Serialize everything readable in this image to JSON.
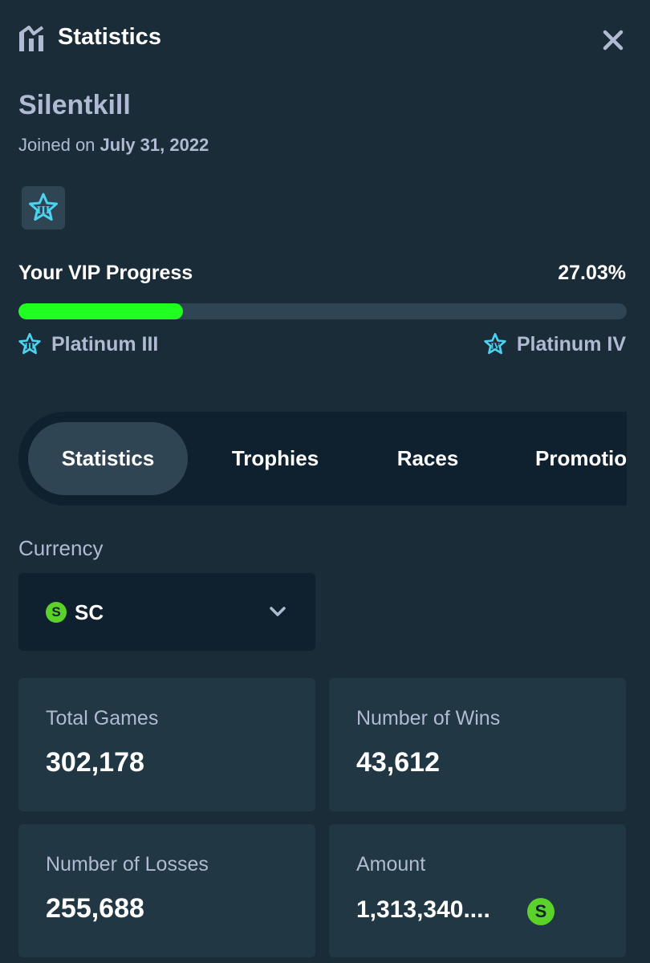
{
  "header": {
    "title": "Statistics",
    "chart_icon": "bar-chart-icon",
    "close_icon": "close-icon"
  },
  "profile": {
    "username": "Silentkill",
    "joined_prefix": "Joined on",
    "joined_date": "July 31, 2022"
  },
  "vip": {
    "label": "Your VIP Progress",
    "percent_text": "27.03%",
    "progress": 0.2703,
    "current_tier": "Platinum III",
    "next_tier": "Platinum IV",
    "current_tier_numeral": "III",
    "next_tier_numeral": "IV"
  },
  "tabs": [
    {
      "label": "Statistics",
      "active": true
    },
    {
      "label": "Trophies",
      "active": false
    },
    {
      "label": "Races",
      "active": false
    },
    {
      "label": "Promotions",
      "active": false
    }
  ],
  "currency": {
    "label": "Currency",
    "value": "SC",
    "coin_letter": "S"
  },
  "stats": {
    "total_games": {
      "label": "Total Games",
      "value": "302,178"
    },
    "wins": {
      "label": "Number of Wins",
      "value": "43,612"
    },
    "losses": {
      "label": "Number of Losses",
      "value": "255,688"
    },
    "amount": {
      "label": "Amount",
      "value": "1,313,340...."
    }
  },
  "colors": {
    "background": "#1a2c38",
    "card": "#213743",
    "dark": "#0f212e",
    "muted_text": "#b1bad3",
    "progress_fill": "#1fff20",
    "coin_green": "#5bd22a",
    "vip_cyan": "#4bd3f0"
  }
}
